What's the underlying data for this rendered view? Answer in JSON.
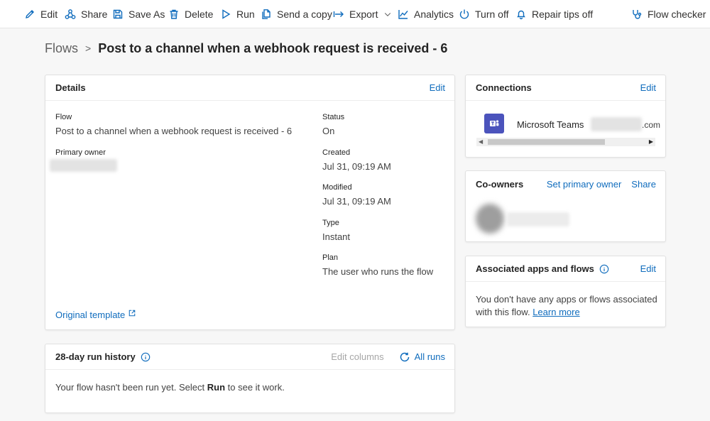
{
  "toolbar": {
    "edit": "Edit",
    "share": "Share",
    "save_as": "Save As",
    "delete": "Delete",
    "run": "Run",
    "send_copy": "Send a copy",
    "export": "Export",
    "analytics": "Analytics",
    "turn_off": "Turn off",
    "repair_tips": "Repair tips off",
    "flow_checker": "Flow checker"
  },
  "breadcrumb": {
    "root": "Flows",
    "separator": ">",
    "title": "Post to a channel when a webhook request is received - 6"
  },
  "details": {
    "title": "Details",
    "edit": "Edit",
    "flow_label": "Flow",
    "flow_value": "Post to a channel when a webhook request is received - 6",
    "owner_label": "Primary owner",
    "status_label": "Status",
    "status_value": "On",
    "created_label": "Created",
    "created_value": "Jul 31, 09:19 AM",
    "modified_label": "Modified",
    "modified_value": "Jul 31, 09:19 AM",
    "type_label": "Type",
    "type_value": "Instant",
    "plan_label": "Plan",
    "plan_value": "The user who runs the flow",
    "template_link": "Original template"
  },
  "run_history": {
    "title": "28-day run history",
    "edit_columns": "Edit columns",
    "all_runs": "All runs",
    "empty_before": "Your flow hasn't been run yet. Select ",
    "empty_bold": "Run",
    "empty_after": " to see it work."
  },
  "connections": {
    "title": "Connections",
    "edit": "Edit",
    "name": "Microsoft Teams",
    "account_suffix": ".com"
  },
  "coowners": {
    "title": "Co-owners",
    "set_primary": "Set primary owner",
    "share": "Share"
  },
  "associated": {
    "title": "Associated apps and flows",
    "edit": "Edit",
    "text": "You don't have any apps or flows associated with this flow. ",
    "learn_more": "Learn more"
  },
  "colors": {
    "accent": "#0f6cbd",
    "teams": "#4b53bc"
  }
}
